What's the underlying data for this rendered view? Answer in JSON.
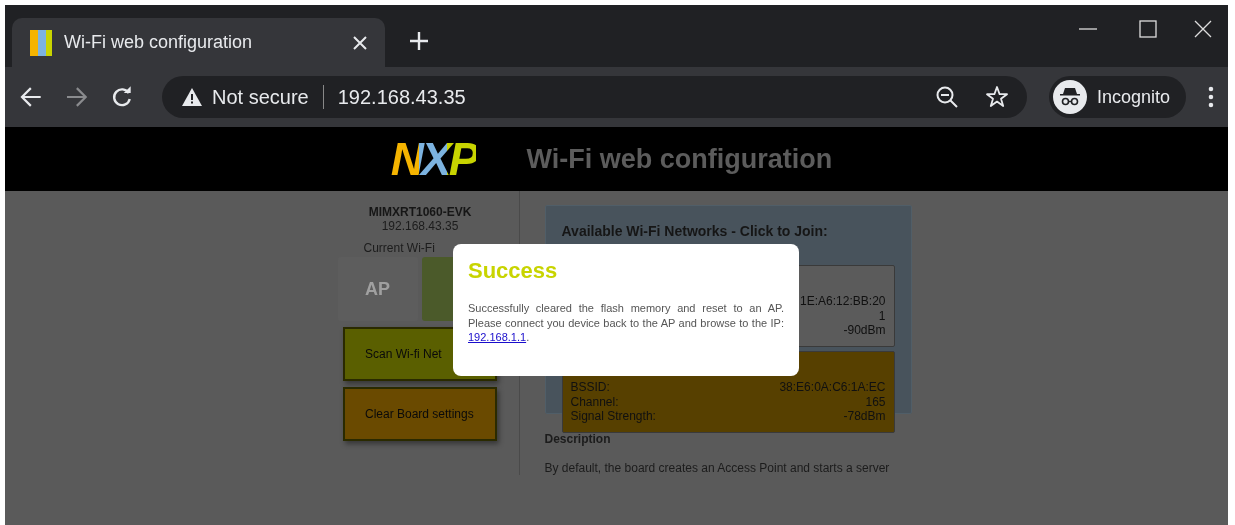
{
  "browser": {
    "tab": {
      "title": "Wi-Fi web configuration",
      "selected": true
    },
    "address": {
      "security": "Not secure",
      "url": "192.168.43.35"
    },
    "profile": "Incognito"
  },
  "page": {
    "header": {
      "logo": "NXP",
      "title": "Wi-Fi web configuration"
    },
    "device": {
      "name": "MIMXRT1060-EVK",
      "ip": "192.168.43.35",
      "mode_label": "Current Wi-Fi",
      "modes": [
        {
          "label": "AP",
          "selected": false
        },
        {
          "selected": true
        }
      ]
    },
    "buttons": [
      {
        "label": "Scan Wi-fi Net",
        "color": "#5a5f00"
      },
      {
        "label": "Clear Board settings",
        "color": "#6a4a00"
      }
    ],
    "networks_panel": {
      "heading": "Available Wi-Fi Networks - Click to Join:",
      "networks": [
        {
          "color": "#5b5b5b",
          "rows": [
            {
              "value": "1E:A6:12:BB:20"
            },
            {
              "value": "1"
            },
            {
              "value": "-90dBm"
            }
          ]
        },
        {
          "color": "#574000",
          "rows": [
            {
              "label": "BSSID:",
              "value": "38:E6:0A:C6:1A:EC"
            },
            {
              "label": "Channel:",
              "value": "165"
            },
            {
              "label": "Signal Strength:",
              "value": "-78dBm"
            }
          ]
        }
      ]
    },
    "description": {
      "heading": "Description",
      "text": "By default, the board creates an Access Point and starts a server"
    }
  },
  "modal": {
    "title": "Success",
    "message_before": "Successfully cleared the flash memory and reset to an AP. Please connect you device back to the AP and browse to the IP: ",
    "link": "192.168.1.1",
    "message_after": "."
  }
}
